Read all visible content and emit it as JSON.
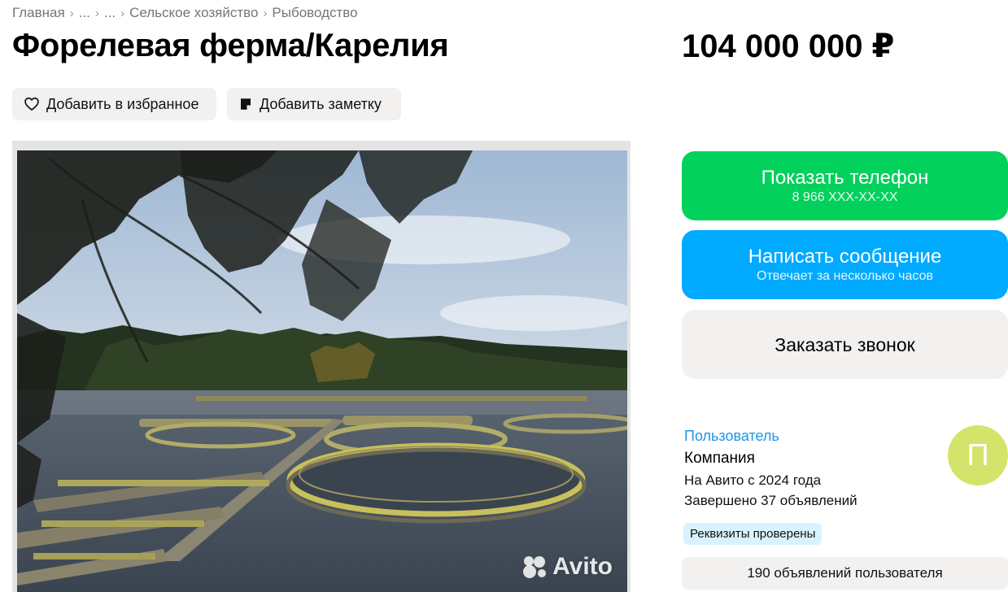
{
  "breadcrumb": [
    "Главная",
    "...",
    "...",
    "Сельское хозяйство",
    "Рыбоводство"
  ],
  "listing": {
    "title": "Форелевая ферма/Карелия",
    "price": "104 000 000 ₽"
  },
  "actions": {
    "favorite_label": "Добавить в избранное",
    "note_label": "Добавить заметку"
  },
  "photo": {
    "watermark": "Avito",
    "alt_description": "trout-farm-lake-photo"
  },
  "contact": {
    "show_phone_label": "Показать телефон",
    "phone_masked": "8 966 XXX-XX-XX",
    "message_label": "Написать сообщение",
    "message_sub": "Отвечает за несколько часов",
    "call_label": "Заказать звонок"
  },
  "seller": {
    "type_link": "Пользователь",
    "name": "Компания",
    "since": "На Авито с 2024 года",
    "completed": "Завершено 37 объявлений",
    "verified_badge": "Реквизиты проверены",
    "avatar_letter": "П",
    "listings_button": "190 объявлений пользователя"
  },
  "colors": {
    "phone_button": "#02d15c",
    "message_button": "#00aaff",
    "neutral_button": "#f2f1f0",
    "link": "#1a97e8",
    "avatar": "#d4e36a",
    "verified_badge": "#d9f2ff"
  },
  "icons": {
    "favorite": "heart-outline-icon",
    "note": "note-icon",
    "breadcrumb_separator": "chevron-right-icon"
  }
}
